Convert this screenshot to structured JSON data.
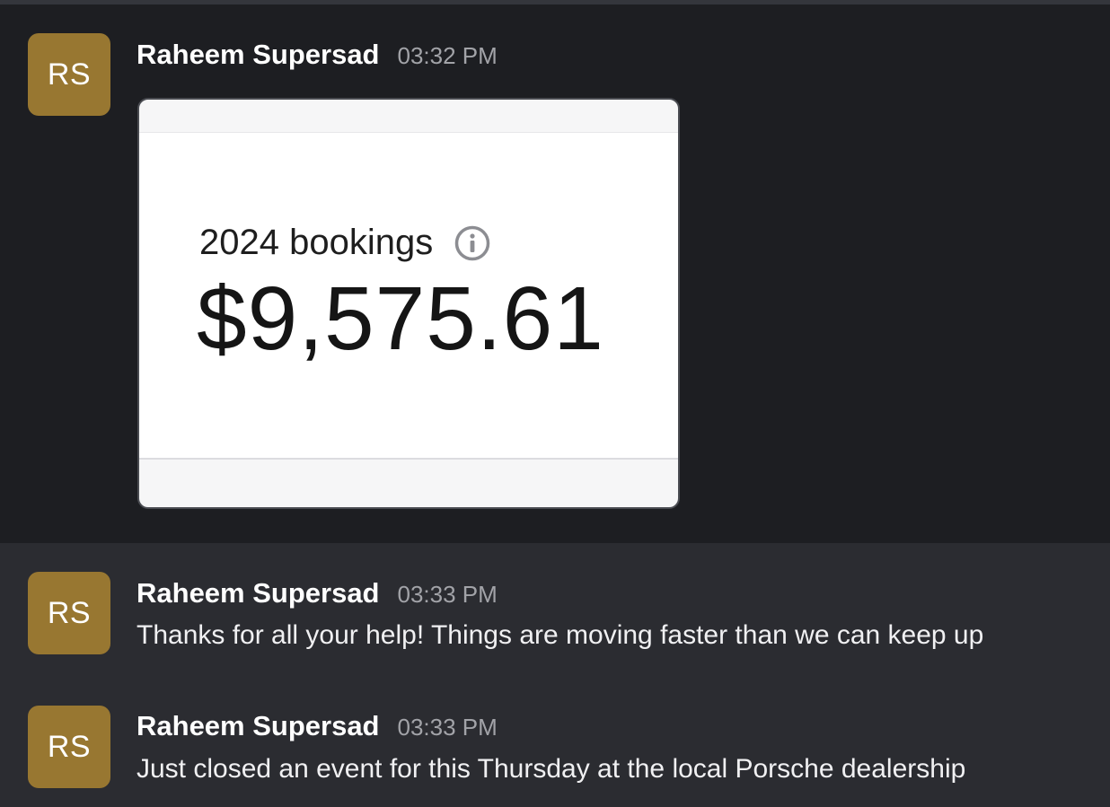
{
  "messages": [
    {
      "avatar_initials": "RS",
      "author": "Raheem Supersad",
      "time": "03:32 PM",
      "attachment": {
        "label": "2024 bookings",
        "info_icon": "info-circle-icon",
        "value": "$9,575.61"
      }
    },
    {
      "avatar_initials": "RS",
      "author": "Raheem Supersad",
      "time": "03:33 PM",
      "text": "Thanks for all your help! Things are moving faster than we can keep up"
    },
    {
      "avatar_initials": "RS",
      "author": "Raheem Supersad",
      "time": "03:33 PM",
      "text": "Just closed an event for this Thursday at the local Porsche dealership"
    }
  ],
  "colors": {
    "avatar_bg": "#987731",
    "highlight_bg": "#1d1e22",
    "background": "#2b2c31"
  }
}
